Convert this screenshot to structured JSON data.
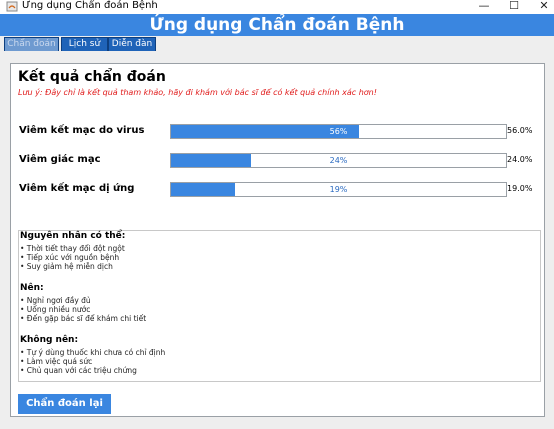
{
  "window": {
    "title": "Ứng dụng Chẩn đoán Bệnh",
    "minimize": "—",
    "maximize": "☐",
    "close": "✕",
    "icon": "java-app-icon"
  },
  "header": {
    "title": "Ứng dụng Chẩn đoán Bệnh"
  },
  "tabs": [
    {
      "label": "Chẩn đoán",
      "active": true
    },
    {
      "label": "Lịch sử",
      "active": false
    },
    {
      "label": "Diễn đàn",
      "active": false
    }
  ],
  "result": {
    "title": "Kết quả chẩn đoán",
    "note": "Lưu ý: Đây chỉ là kết quả tham khảo, hãy đi khám với bác sĩ để có kết quả chính xác hơn!",
    "diagnoses": [
      {
        "name": "Viêm kết mạc do virus",
        "bar_label": "56%",
        "percent_label": "56.0%",
        "value": 0.56
      },
      {
        "name": "Viêm giác mạc",
        "bar_label": "24%",
        "percent_label": "24.0%",
        "value": 0.24
      },
      {
        "name": "Viêm kết mạc dị ứng",
        "bar_label": "19%",
        "percent_label": "19.0%",
        "value": 0.19
      }
    ]
  },
  "info": {
    "causes": {
      "title": "Nguyên nhân có thể:",
      "items": [
        "• Thời tiết thay đổi đột ngột",
        "• Tiếp xúc với nguồn bệnh",
        "• Suy giảm hệ miễn dịch"
      ]
    },
    "do": {
      "title": "Nên:",
      "items": [
        "• Nghỉ ngơi đầy đủ",
        "• Uống nhiều nước",
        "• Đến gặp bác sĩ để khám chi tiết"
      ]
    },
    "dont": {
      "title": "Không nên:",
      "items": [
        "• Tự ý dùng thuốc khi chưa có chỉ định",
        "• Làm việc quá sức",
        "• Chủ quan với các triệu chứng"
      ]
    }
  },
  "actions": {
    "rediagnose": "Chẩn đoán lại"
  },
  "colors": {
    "accent": "#3a86e0",
    "tab": "#1f63b8",
    "warning": "#e01b1b"
  }
}
